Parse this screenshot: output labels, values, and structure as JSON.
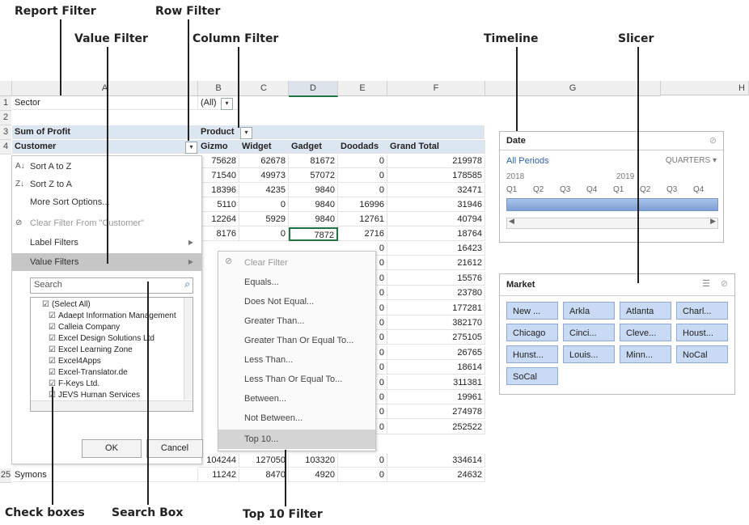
{
  "callouts": {
    "report_filter": "Report Filter",
    "row_filter": "Row Filter",
    "value_filter": "Value Filter",
    "column_filter": "Column Filter",
    "timeline": "Timeline",
    "slicer": "Slicer",
    "check_boxes": "Check boxes",
    "search_box": "Search Box",
    "top10_filter": "Top 10 Filter"
  },
  "sheet": {
    "columns": [
      "A",
      "B",
      "C",
      "D",
      "E",
      "F",
      "G",
      "H"
    ],
    "row_numbers": [
      "1",
      "2",
      "3",
      "4",
      "25"
    ],
    "a1": "Sector",
    "b1": "(All)",
    "a3": "Sum of Profit",
    "b3": "Product",
    "a4": "Customer",
    "headers": [
      "Gizmo",
      "Widget",
      "Gadget",
      "Doodads",
      "Grand Total"
    ],
    "rows": [
      [
        "75628",
        "62678",
        "81672",
        "0",
        "219978"
      ],
      [
        "71540",
        "49973",
        "57072",
        "0",
        "178585"
      ],
      [
        "18396",
        "4235",
        "9840",
        "0",
        "32471"
      ],
      [
        "5110",
        "0",
        "9840",
        "16996",
        "31946"
      ],
      [
        "12264",
        "5929",
        "9840",
        "12761",
        "40794"
      ],
      [
        "8176",
        "0",
        "7872",
        "2716",
        "18764"
      ]
    ],
    "tail_e": [
      "0",
      "0",
      "0",
      "0",
      "0",
      "0",
      "0",
      "0",
      "0",
      "0",
      "0",
      "0",
      "0"
    ],
    "tail_f": [
      "16423",
      "21612",
      "15576",
      "23780",
      "177281",
      "382170",
      "275105",
      "26765",
      "18614",
      "311381",
      "19961",
      "274978",
      "252522"
    ],
    "row24": [
      "104244",
      "127050",
      "103320",
      "0",
      "334614"
    ],
    "a25": "Symons",
    "row25": [
      "11242",
      "8470",
      "4920",
      "0",
      "24632"
    ]
  },
  "menu": {
    "sort_az": "Sort A to Z",
    "sort_za": "Sort Z to A",
    "more_sort": "More Sort Options...",
    "clear_filter": "Clear Filter From \"Customer\"",
    "label_filters": "Label Filters",
    "value_filters": "Value Filters",
    "search_placeholder": "Search",
    "items": [
      "(Select All)",
      "Adaept Information Management",
      "Calleia Company",
      "Excel Design Solutions Ltd",
      "Excel Learning Zone",
      "Excel4Apps",
      "Excel-Translator.de",
      "F-Keys Ltd.",
      "JEVS Human Services"
    ],
    "ok": "OK",
    "cancel": "Cancel"
  },
  "submenu": {
    "items": [
      "Clear Filter",
      "Equals...",
      "Does Not Equal...",
      "Greater Than...",
      "Greater Than Or Equal To...",
      "Less Than...",
      "Less Than Or Equal To...",
      "Between...",
      "Not Between...",
      "Top 10..."
    ]
  },
  "timeline": {
    "title": "Date",
    "all_periods": "All Periods",
    "level": "QUARTERS ▾",
    "year1": "2018",
    "year2": "2019",
    "quarters": [
      "Q1",
      "Q2",
      "Q3",
      "Q4",
      "Q1",
      "Q2",
      "Q3",
      "Q4"
    ]
  },
  "slicer": {
    "title": "Market",
    "buttons": [
      "New ...",
      "Arkla",
      "Atlanta",
      "Charl...",
      "Chicago",
      "Cinci...",
      "Cleve...",
      "Houst...",
      "Hunst...",
      "Louis...",
      "Minn...",
      "NoCal",
      "SoCal"
    ]
  }
}
